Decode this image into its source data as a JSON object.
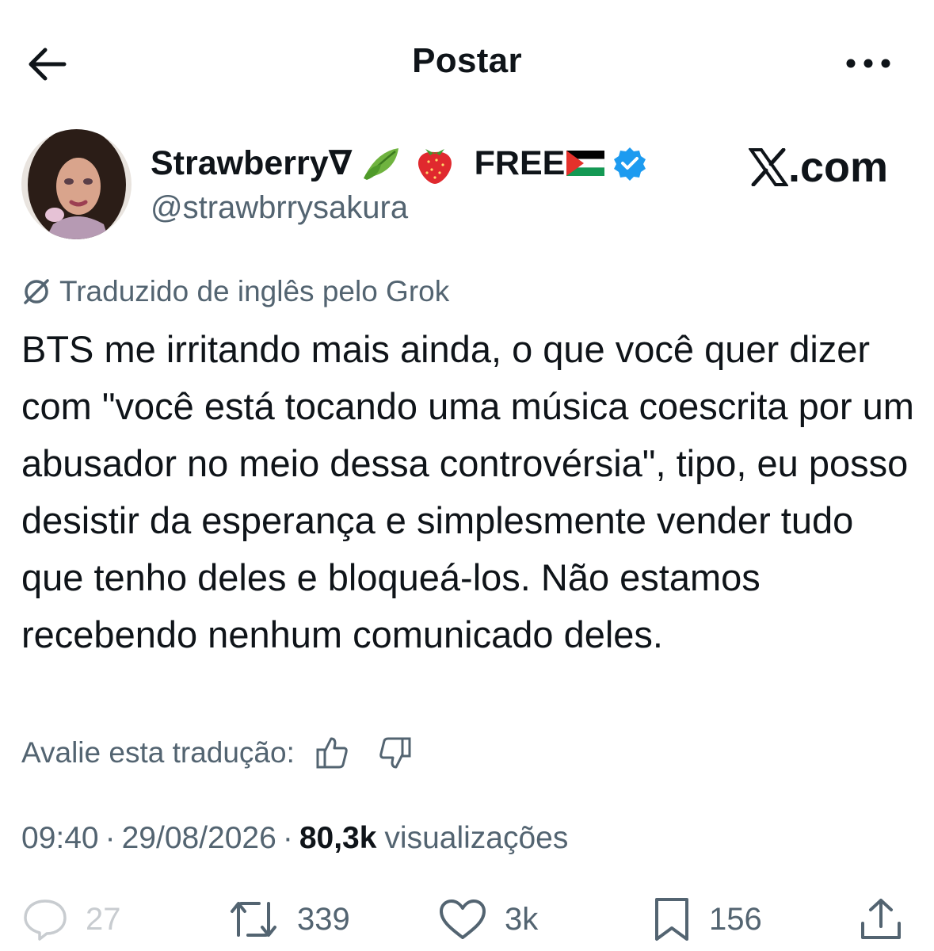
{
  "header": {
    "title": "Postar"
  },
  "author": {
    "display_name": "Strawberry∇",
    "name_suffix": "FREE",
    "handle": "@strawbrrysakura",
    "verified": true,
    "emojis": [
      "herb-emoji",
      "strawberry-emoji",
      "palestine-flag-emoji"
    ]
  },
  "watermark": {
    "text": ".com"
  },
  "translation": {
    "label": "Traduzido de inglês pelo Grok",
    "rate_label": "Avalie esta tradução:"
  },
  "post": {
    "text": "BTS me irritando mais ainda, o que você quer dizer com \"você está tocando uma música coescrita por um abusador no meio dessa controvérsia\", tipo, eu posso desistir da esperança e simplesmente vender tudo que tenho deles e bloqueá-los. Não estamos recebendo nenhum comunicado deles.",
    "time": "09:40",
    "date": "29/08/2026",
    "separator": "·",
    "views_count": "80,3k",
    "views_label": "visualizações"
  },
  "actions": {
    "replies": "27",
    "reposts": "339",
    "likes": "3k",
    "bookmarks": "156"
  },
  "colors": {
    "text": "#0f1419",
    "secondary": "#536471",
    "verified": "#1d9bf0"
  }
}
